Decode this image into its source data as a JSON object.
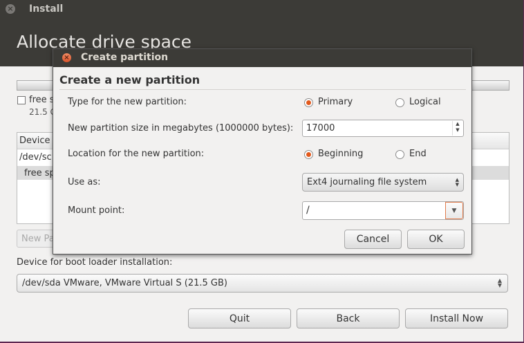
{
  "window": {
    "title": "Install",
    "page_title": "Allocate drive space"
  },
  "partitions": {
    "free_label": "free s",
    "free_size": "21.5 G",
    "header_device": "Device",
    "rows": [
      "/dev/sc",
      "free sp"
    ],
    "new_partition_button": "New Pa"
  },
  "boot": {
    "label": "Device for boot loader installation:",
    "selected": "/dev/sda VMware, VMware Virtual S (21.5 GB)"
  },
  "buttons": {
    "quit": "Quit",
    "back": "Back",
    "install_now": "Install Now"
  },
  "dialog": {
    "title": "Create partition",
    "heading": "Create a new partition",
    "type_label": "Type for the new partition:",
    "type_primary": "Primary",
    "type_logical": "Logical",
    "type_selected": "Primary",
    "size_label": "New partition size in megabytes (1000000 bytes):",
    "size_value": "17000",
    "location_label": "Location for the new partition:",
    "location_beginning": "Beginning",
    "location_end": "End",
    "location_selected": "Beginning",
    "use_as_label": "Use as:",
    "use_as_value": "Ext4 journaling file system",
    "mount_label": "Mount point:",
    "mount_value": "/",
    "cancel": "Cancel",
    "ok": "OK"
  },
  "colors": {
    "titlebar": "#3c3b37",
    "accent": "#e2591c",
    "window_bg": "#f2f1f0"
  }
}
